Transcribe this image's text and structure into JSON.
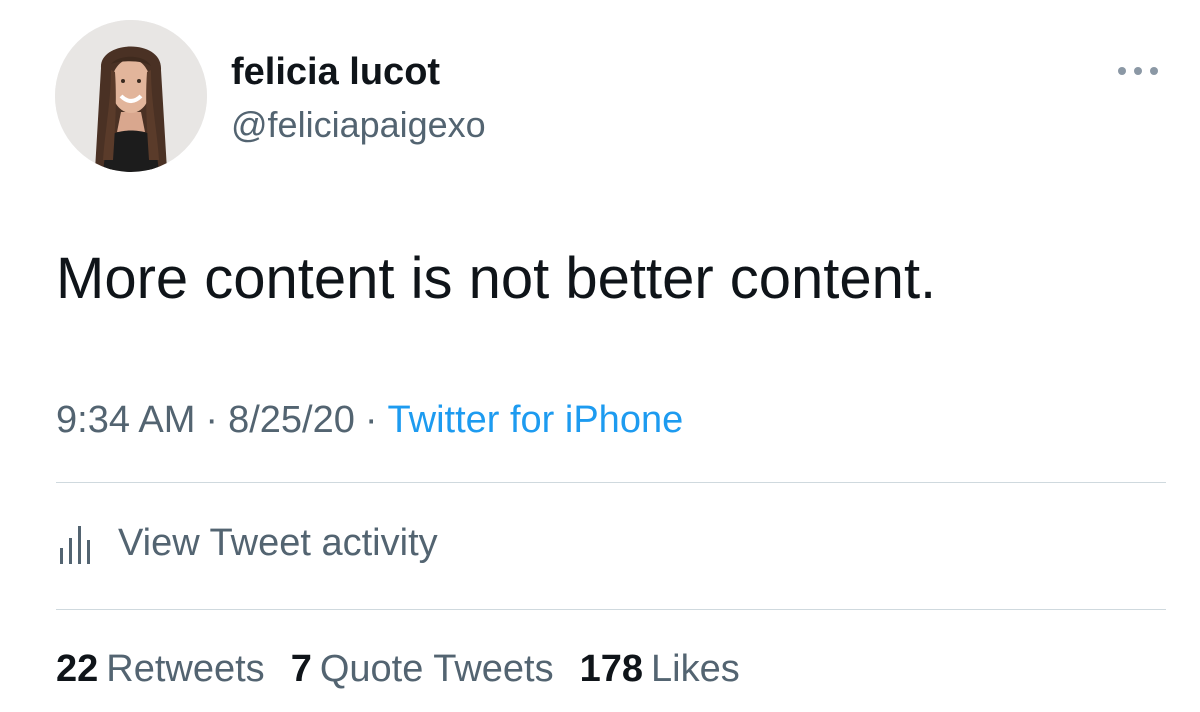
{
  "author": {
    "display_name": "felicia lucot",
    "handle": "@feliciapaigexo",
    "avatar": "profile-photo"
  },
  "tweet": {
    "text": "More content is not better content.",
    "time": "9:34 AM",
    "date": "8/25/20",
    "separator": "·",
    "source": "Twitter for iPhone"
  },
  "actions": {
    "more_icon": "more-horizontal-icon",
    "activity_icon": "bar-chart-icon",
    "activity_label": "View Tweet activity"
  },
  "stats": {
    "retweets_count": "22",
    "retweets_label": "Retweets",
    "quotes_count": "7",
    "quotes_label": "Quote Tweets",
    "likes_count": "178",
    "likes_label": "Likes"
  },
  "colors": {
    "text_primary": "#0f1419",
    "text_secondary": "#536471",
    "link": "#1d9bf0",
    "divider": "#cfd9de"
  }
}
